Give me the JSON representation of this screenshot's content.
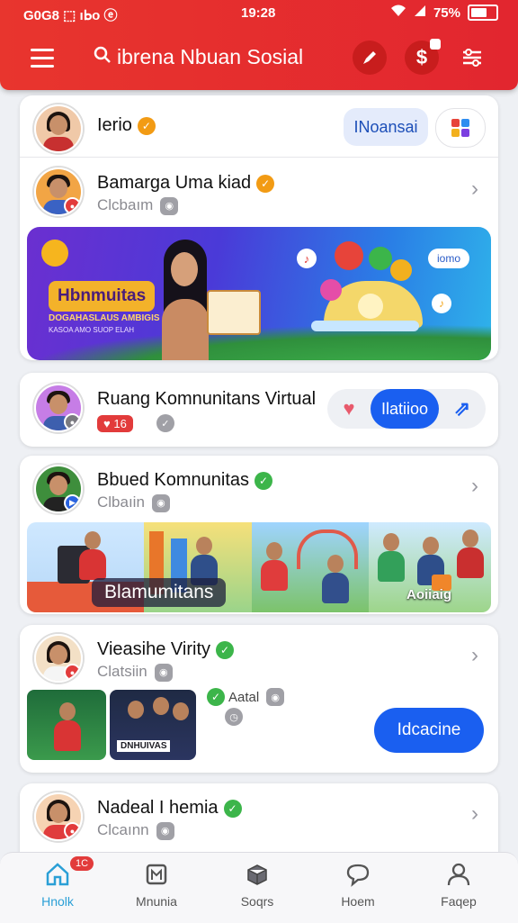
{
  "status": {
    "left": "G0G8 ⬚ ıᖯo ⓔ",
    "time": "19:28",
    "battery_text": "75%",
    "battery_level": 0.75
  },
  "header": {
    "title": "ibrena Nbuan Sosial",
    "icons": [
      "menu-icon",
      "search-icon",
      "pen-icon",
      "profile-notify-icon",
      "settings-icon"
    ]
  },
  "feed": {
    "top_user": {
      "name": "Ierio",
      "button_label": "INoansai"
    },
    "card1": {
      "name": "Bamarga Uma kiad",
      "sub": "Clcbaım",
      "banner": {
        "title": "Hbnmuitas",
        "subtitle": "DOGAHASLAUS AMBIGIS",
        "small": "KASOA AMO SUOP ELAH",
        "chip": "iomo"
      }
    },
    "card2": {
      "name": "Ruang Komnunitans Virtual",
      "counter": "16",
      "button_label": "Ilatiioo"
    },
    "card3": {
      "name": "Bbued Komnunitas",
      "sub": "Clbaıin",
      "strip_label": "Blamumitans",
      "strip_label2": "Aoiiaig"
    },
    "card4": {
      "name": "Vieasihe Virity",
      "sub": "Clatsiin",
      "tag": "Aatal",
      "thumb_label": "DNHUIVAS",
      "button_label": "Idcacine"
    },
    "card5": {
      "name": "Nadeal I hemia",
      "sub": "Clcaınn"
    }
  },
  "nav": [
    {
      "label": "Hnolk",
      "icon": "home-icon",
      "badge": "1C",
      "active": true
    },
    {
      "label": "Mnunia",
      "icon": "community-icon"
    },
    {
      "label": "Soqrs",
      "icon": "box-icon"
    },
    {
      "label": "Hoem",
      "icon": "chat-icon"
    },
    {
      "label": "Faqep",
      "icon": "person-icon"
    }
  ],
  "colors": {
    "brand_red": "#e3302d",
    "accent_blue": "#1a5ff0",
    "verified_orange": "#f29b14",
    "verified_green": "#3cb54a"
  }
}
